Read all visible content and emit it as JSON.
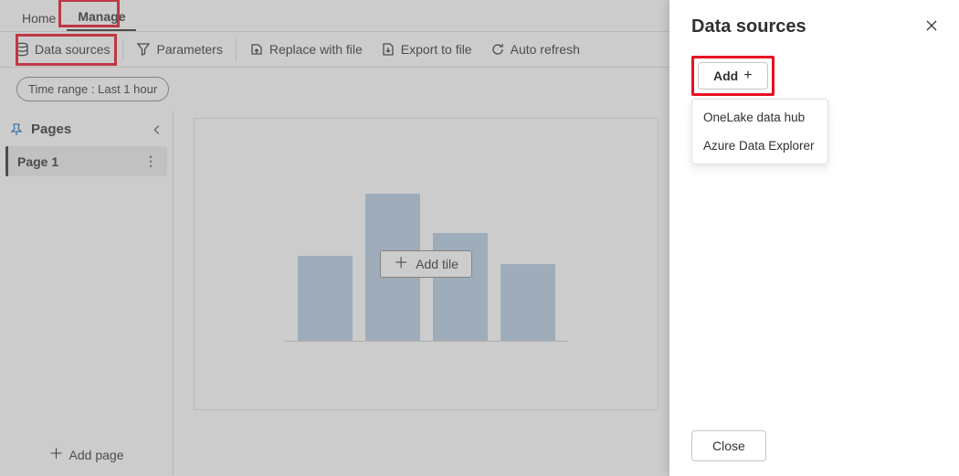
{
  "tabs": {
    "home": "Home",
    "manage": "Manage"
  },
  "toolbar": {
    "data_sources": "Data sources",
    "parameters": "Parameters",
    "replace": "Replace with file",
    "export": "Export to file",
    "auto_refresh": "Auto refresh"
  },
  "filter": {
    "time_range_label": "Time range : ",
    "time_range_value": "Last 1 hour"
  },
  "sidebar": {
    "title": "Pages",
    "pages": [
      {
        "name": "Page 1"
      }
    ],
    "add_page": "Add page"
  },
  "canvas": {
    "add_tile": "Add tile"
  },
  "panel": {
    "title": "Data sources",
    "add": "Add",
    "menu": [
      "OneLake data hub",
      "Azure Data Explorer"
    ],
    "close": "Close"
  }
}
